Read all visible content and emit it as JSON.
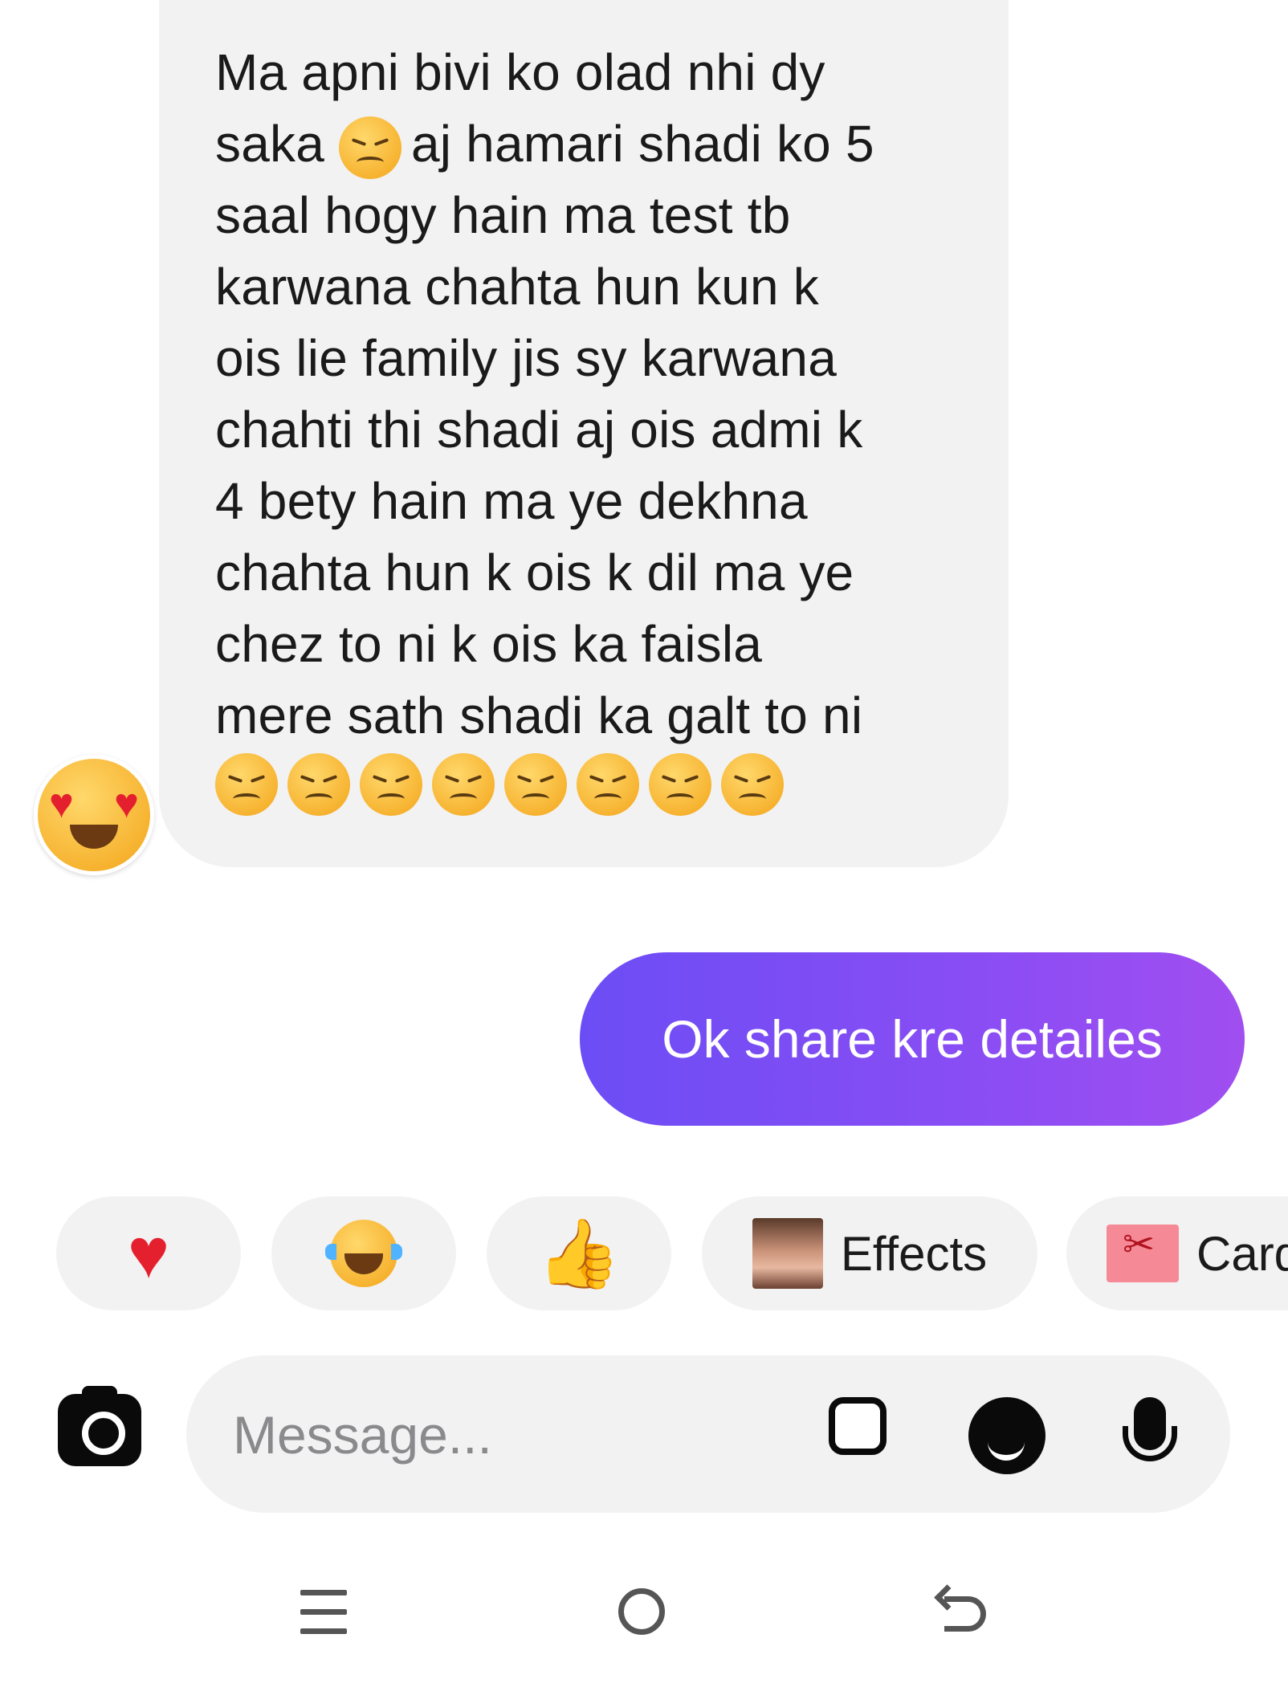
{
  "thread": {
    "incoming": {
      "text": "Ma apni bivi ko olad nhi dy\nsaka",
      "text_after_emoji": "aj hamari shadi ko 5\nsaal hogy hain ma test tb\nkarwana chahta hun kun k\nois lie family jis sy karwana\nchahti thi shadi aj ois admi k\n4 bety hain ma ye dekhna\nchahta hun k ois k dil ma ye\nchez to ni k ois ka faisla\nmere sath shadi ka galt to ni",
      "inline_emoji": "disappointed-face-emoji",
      "trailing_emojis": [
        "confounded-face-emoji",
        "confounded-face-emoji",
        "confounded-face-emoji",
        "confounded-face-emoji",
        "confounded-face-emoji",
        "confounded-face-emoji",
        "confounded-face-emoji",
        "confounded-face-emoji"
      ],
      "reaction": "heart-eyes-emoji"
    },
    "outgoing": {
      "text": "Ok share kre detailes",
      "gradient": [
        "#6c4df5",
        "#a04ef0"
      ]
    }
  },
  "quick_actions": [
    {
      "icon": "heart-icon",
      "label": ""
    },
    {
      "icon": "laughing-tears-icon",
      "label": ""
    },
    {
      "icon": "thumbs-up-icon",
      "label": ""
    },
    {
      "icon": "effects-avatar-icon",
      "label": "Effects"
    },
    {
      "icon": "gift-card-icon",
      "label": "Card"
    }
  ],
  "composer": {
    "placeholder": "Message...",
    "icons": [
      "camera-icon",
      "gallery-icon",
      "sticker-icon",
      "microphone-icon"
    ]
  },
  "system_nav": {
    "buttons": [
      "recent-apps-icon",
      "home-icon",
      "back-icon"
    ]
  },
  "colors": {
    "incoming_bubble": "#f2f2f3",
    "accent": "#7b4df4",
    "heart": "#e5202e"
  }
}
